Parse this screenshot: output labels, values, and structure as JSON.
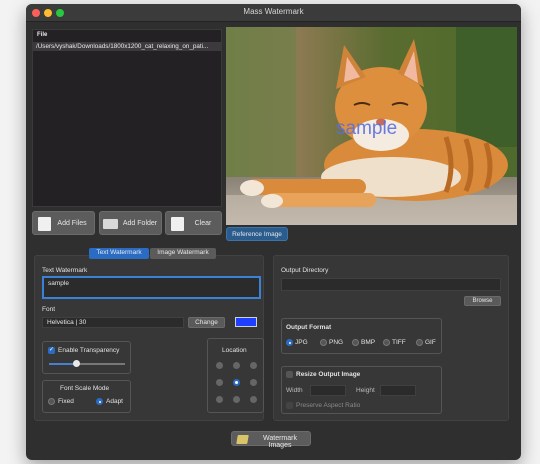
{
  "window": {
    "title": "Mass Watermark"
  },
  "file_list": {
    "header": "File",
    "items": [
      "/Users/vyshak/Downloads/1800x1200_cat_relaxing_on_pati..."
    ]
  },
  "preview": {
    "watermark_overlay": "sample"
  },
  "buttons": {
    "add_files": "Add Files",
    "add_folder": "Add Folder",
    "clear": "Clear",
    "reference_image": "Reference Image",
    "watermark_images": "Watermark Images",
    "change": "Change",
    "browse": "Browse"
  },
  "tabs": {
    "text": "Text Watermark",
    "image": "Image Watermark"
  },
  "text_watermark": {
    "label": "Text Watermark",
    "value": "sample",
    "font_label": "Font",
    "font_value": "Helvetica | 30",
    "swatch_color": "#1f3fff",
    "enable_transparency": "Enable Transparency",
    "transparency_value": 0.3,
    "font_scale_mode": "Font Scale Mode",
    "fixed": "Fixed",
    "adapt": "Adapt",
    "location": "Location",
    "selected_location": "center"
  },
  "output": {
    "directory_label": "Output Directory",
    "directory_value": "",
    "format_label": "Output Format",
    "formats": [
      "JPG",
      "PNG",
      "BMP",
      "TIFF",
      "GIF"
    ],
    "selected_format": "JPG",
    "resize_label": "Resize Output Image",
    "width_label": "Width",
    "height_label": "Height",
    "preserve_label": "Preserve Aspect Ratio"
  },
  "colors": {
    "accent": "#2a6cc3",
    "background": "#2f2f2f"
  }
}
